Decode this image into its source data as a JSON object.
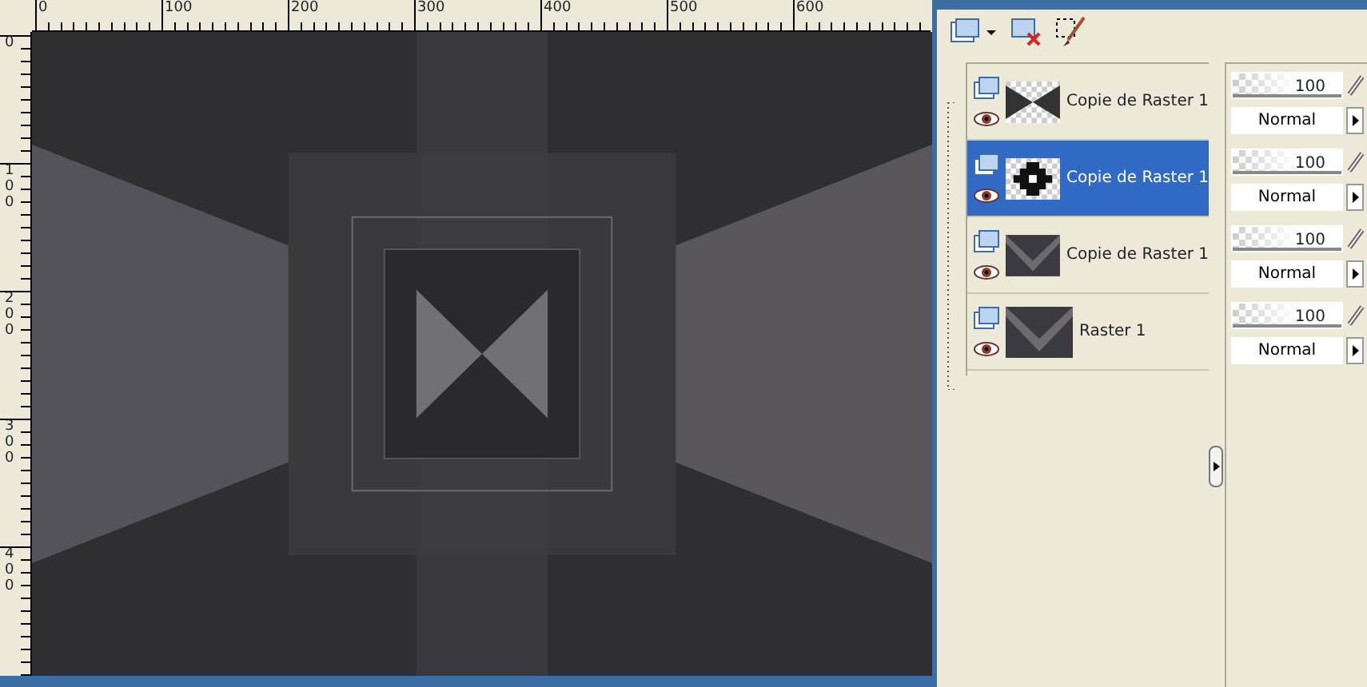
{
  "layers": [
    {
      "name": "Copie de Raster 1",
      "selected": false,
      "visible": true,
      "kind": "bowtie",
      "opacity": "100",
      "level": 1,
      "blend_mode": "Normal"
    },
    {
      "name": "Copie de Raster 1",
      "selected": true,
      "visible": true,
      "kind": "cross",
      "opacity": "100",
      "level": 1,
      "blend_mode": "Normal"
    },
    {
      "name": "Copie de Raster 1",
      "selected": false,
      "visible": true,
      "kind": "artwork",
      "opacity": "100",
      "level": 1,
      "blend_mode": "Normal"
    },
    {
      "name": "Raster 1",
      "selected": false,
      "visible": true,
      "kind": "artwork",
      "opacity": "100",
      "level": 1,
      "blend_mode": "Normal"
    }
  ],
  "rulers": {
    "horizontal": [
      "0",
      "100",
      "200",
      "300",
      "400",
      "500",
      "600"
    ],
    "vertical": [
      "0",
      "100",
      "200",
      "300",
      "400"
    ]
  }
}
